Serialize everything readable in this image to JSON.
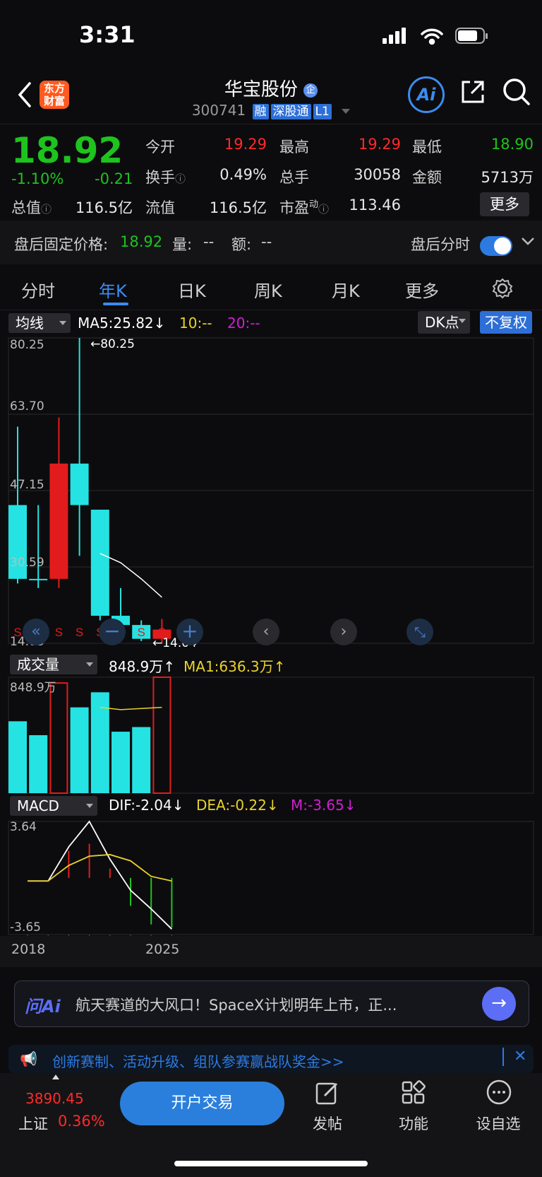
{
  "status": {
    "time": "3:31"
  },
  "header": {
    "title": "华宝股份",
    "code": "300741",
    "tags": [
      "融",
      "深股通",
      "L1"
    ],
    "logo": "东方\n财富",
    "ai": "Ai"
  },
  "quote": {
    "price": "18.92",
    "change_pct": "-1.10%",
    "change": "-0.21",
    "open_label": "今开",
    "open": "19.29",
    "high_label": "最高",
    "high": "19.29",
    "low_label": "最低",
    "low": "18.90",
    "turnover_label": "换手",
    "turnover": "0.49%",
    "volume_label": "总手",
    "volume": "30058",
    "amount_label": "金额",
    "amount": "5713万",
    "mktcap_label": "总值",
    "mktcap": "116.5亿",
    "float_label": "流值",
    "float": "116.5亿",
    "pe_label": "市盈",
    "pe_sup": "动",
    "pe": "113.46",
    "more": "更多"
  },
  "after_hours": {
    "label": "盘后固定价格:",
    "price": "18.92",
    "vol_label": "量:",
    "vol": "--",
    "amt_label": "额:",
    "amt": "--",
    "intraday_label": "盘后分时"
  },
  "tabs": [
    "分时",
    "年K",
    "日K",
    "周K",
    "月K",
    "更多"
  ],
  "kline": {
    "ma_select": "均线",
    "ma5": "MA5:25.82",
    "ma10": "10:--",
    "ma20": "20:--",
    "dk": "DK点",
    "fq": "不复权",
    "y_labels": [
      "80.25",
      "63.70",
      "47.15",
      "30.59",
      "14.03"
    ],
    "max_note": "←80.25",
    "min_note": "←14.04"
  },
  "volume": {
    "select": "成交量",
    "value": "848.9万",
    "ma1": "MA1:636.3万",
    "y_top": "848.9万"
  },
  "macd": {
    "select": "MACD",
    "dif": "DIF:-2.04",
    "dea": "DEA:-0.22",
    "m": "M:-3.65",
    "y_top": "3.64",
    "y_bottom": "-3.65",
    "x_start": "2018",
    "x_end": "2025"
  },
  "chart_data": {
    "type": "candlestick",
    "candles": [
      {
        "o": 44,
        "c": 28,
        "h": 61,
        "l": 27,
        "up": false
      },
      {
        "o": 28,
        "c": 28,
        "h": 44,
        "l": 26,
        "up": false
      },
      {
        "o": 28,
        "c": 53,
        "h": 63,
        "l": 26,
        "up": true
      },
      {
        "o": 53,
        "c": 44,
        "h": 80.25,
        "l": 33,
        "up": false
      },
      {
        "o": 43,
        "c": 20,
        "h": 43,
        "l": 19,
        "up": false
      },
      {
        "o": 20,
        "c": 18,
        "h": 26,
        "l": 16,
        "up": false
      },
      {
        "o": 18,
        "c": 15,
        "h": 19,
        "l": 14.5,
        "up": false
      },
      {
        "o": 17,
        "c": 15,
        "h": 19.3,
        "l": 14.04,
        "up": true
      }
    ],
    "ma5": [
      null,
      null,
      null,
      null,
      33.5,
      31.5,
      28,
      24
    ],
    "ylim": [
      14.03,
      80.25
    ],
    "volumes": [
      0.62,
      0.5,
      0.95,
      0.74,
      0.87,
      0.53,
      0.57,
      1.0
    ],
    "vol_ma": [
      null,
      null,
      null,
      null,
      0.74,
      0.72,
      0.73,
      0.74
    ],
    "vol_up": [
      false,
      false,
      true,
      false,
      false,
      false,
      false,
      true
    ],
    "macd_dif": [
      -0.2,
      -0.2,
      2.0,
      3.64,
      1.2,
      -0.8,
      -2.0,
      -3.3
    ],
    "macd_dea": [
      -0.2,
      -0.2,
      0.8,
      1.4,
      1.5,
      1.1,
      0.1,
      -0.2
    ],
    "macd_hist": [
      0,
      0,
      3.5,
      4.4,
      1.2,
      -3.6,
      -6.0,
      -6.4
    ],
    "macd_ylim": [
      -3.65,
      3.64
    ]
  },
  "ai_bar": {
    "label": "问Ai",
    "text": "航天赛道的大风口！SpaceX计划明年上市，正..."
  },
  "banner": {
    "text": "创新赛制、活动升级、组队参赛赢战队奖金>>"
  },
  "bottom": {
    "index_value": "3890.45",
    "index_name": "上证",
    "index_pct": "0.36%",
    "open": "开户交易",
    "post": "发帖",
    "func": "功能",
    "watch": "设自选"
  }
}
